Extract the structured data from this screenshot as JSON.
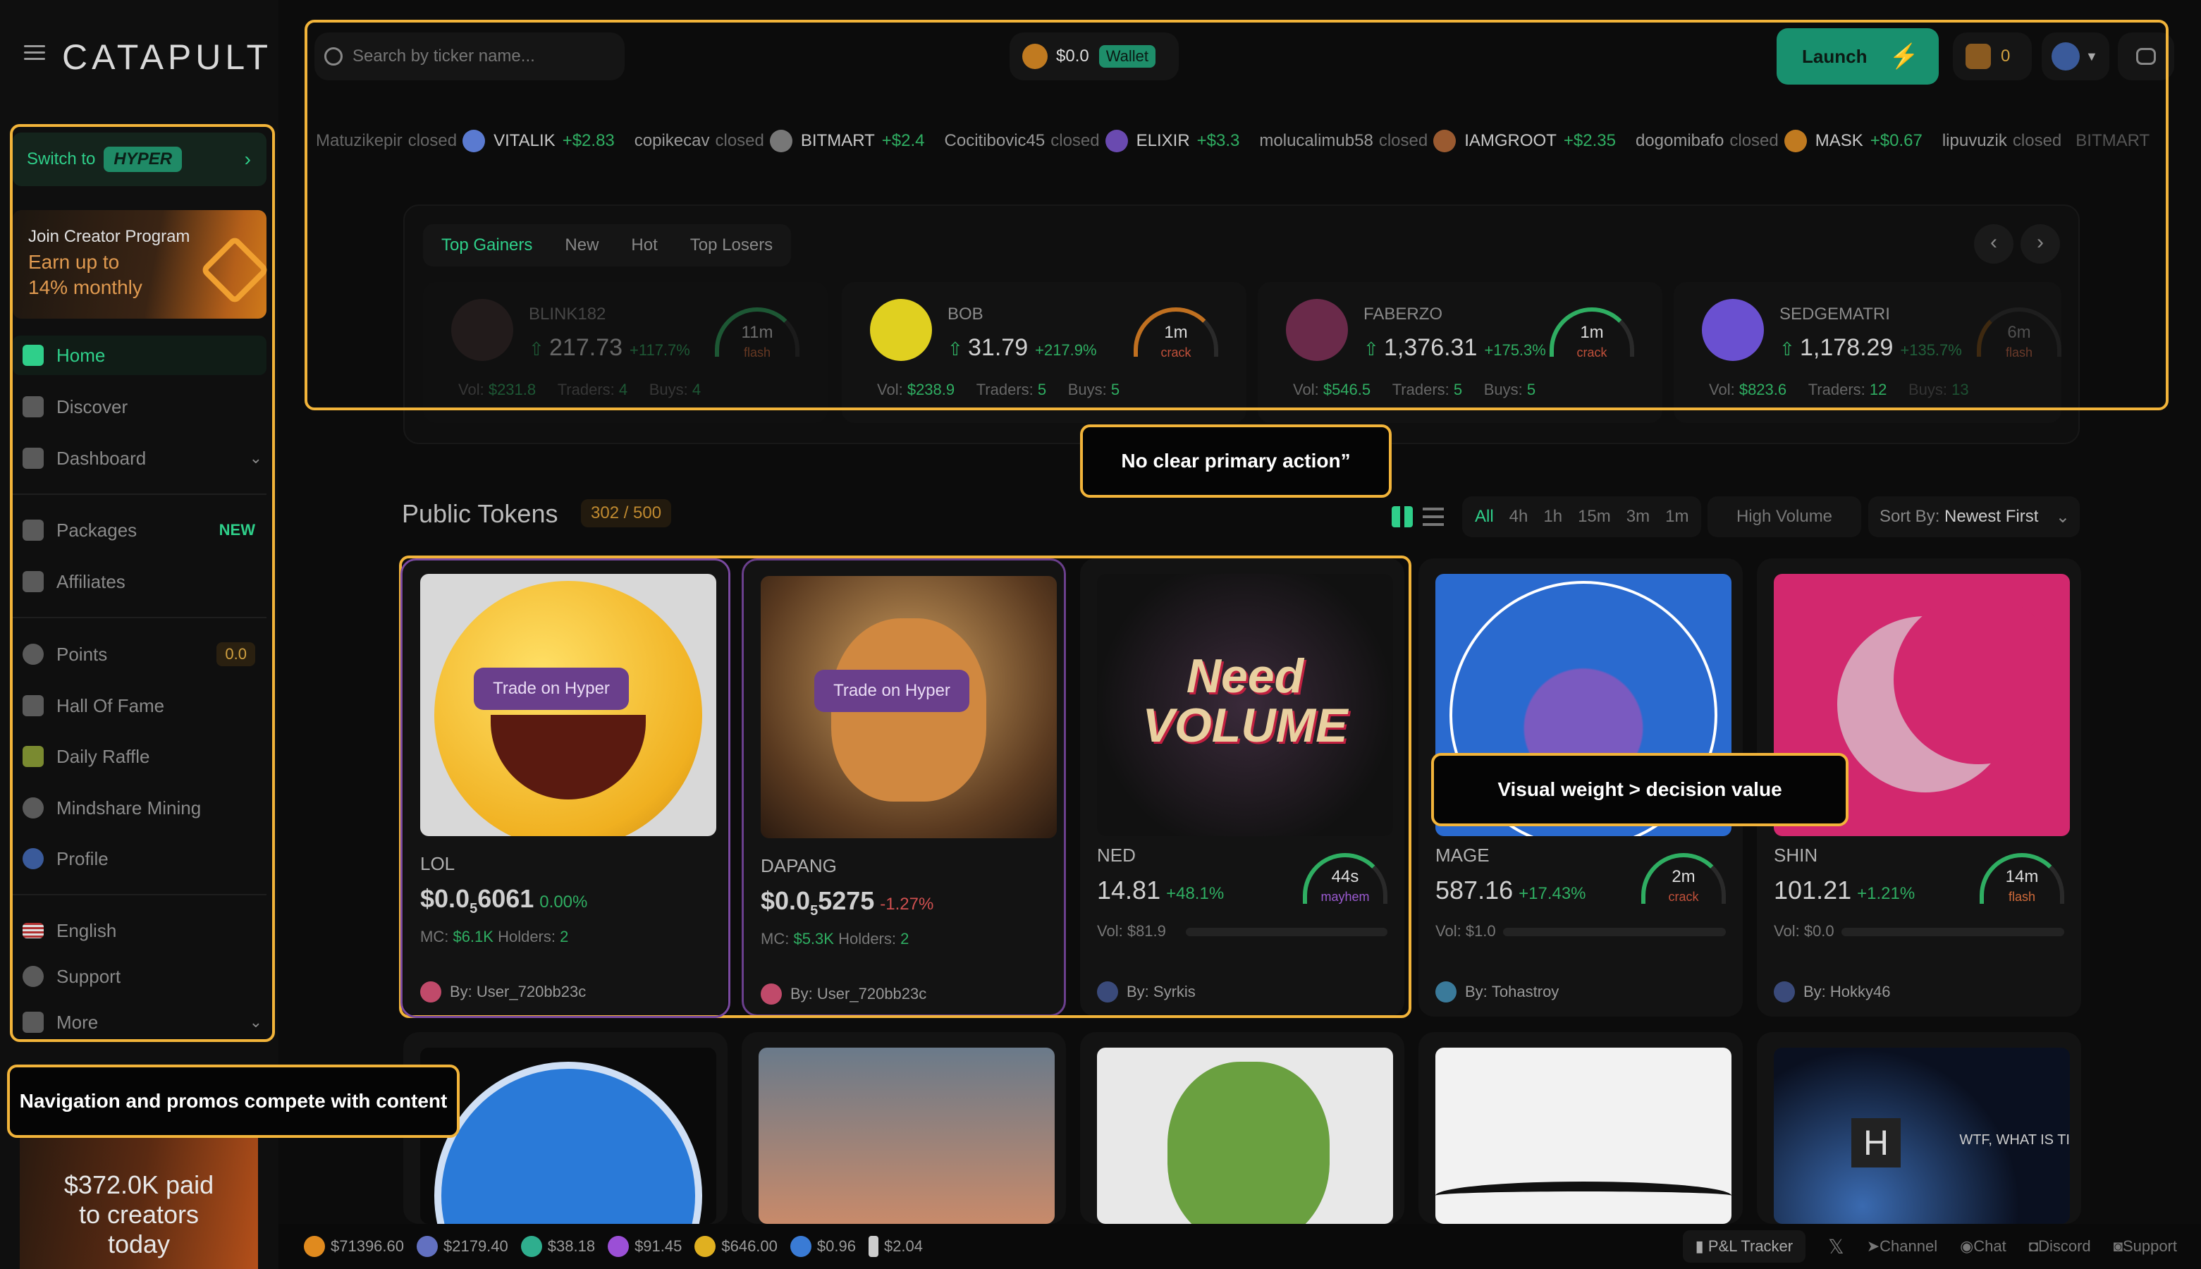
{
  "app": {
    "logo": "CATAPULT"
  },
  "search": {
    "placeholder": "Search by ticker name..."
  },
  "wallet": {
    "balance": "$0.0",
    "badge": "Wallet"
  },
  "header": {
    "launch_label": "Launch",
    "points": "0"
  },
  "sidebar": {
    "switch_label": "Switch to",
    "switch_badge": "HYPER",
    "promo": {
      "line1": "Join Creator Program",
      "line2": "Earn up to",
      "line3": "14% monthly"
    },
    "items": [
      {
        "label": "Home",
        "icon": "home-icon"
      },
      {
        "label": "Discover",
        "icon": "chart-icon"
      },
      {
        "label": "Dashboard",
        "icon": "grid-icon"
      },
      {
        "label": "Packages",
        "icon": "coins-icon",
        "badge": "NEW"
      },
      {
        "label": "Affiliates",
        "icon": "users-icon"
      },
      {
        "label": "Points",
        "icon": "plus-circle-icon",
        "value": "0.0"
      },
      {
        "label": "Hall Of Fame",
        "icon": "trophy-icon"
      },
      {
        "label": "Daily Raffle",
        "icon": "raffle-icon"
      },
      {
        "label": "Mindshare Mining",
        "icon": "dollar-icon"
      },
      {
        "label": "Profile",
        "icon": "avatar-icon"
      },
      {
        "label": "English",
        "icon": "flag-us-icon"
      },
      {
        "label": "Support",
        "icon": "help-icon"
      },
      {
        "label": "More",
        "icon": "more-icon"
      }
    ],
    "paid": {
      "line1": "$372.0K paid",
      "line2": "to creators",
      "line3": "today"
    }
  },
  "ticker": [
    {
      "user": "Matuzikepir",
      "status": "closed",
      "token": "VITALIK",
      "change": "+$2.83"
    },
    {
      "user": "copikecav",
      "status": "closed",
      "token": "BITMART",
      "change": "+$2.4"
    },
    {
      "user": "Cocitibovic45",
      "status": "closed",
      "token": "ELIXIR",
      "change": "+$3.3"
    },
    {
      "user": "molucalimub58",
      "status": "closed",
      "token": "IAMGROOT",
      "change": "+$2.35"
    },
    {
      "user": "dogomibafo",
      "status": "closed",
      "token": "MASK",
      "change": "+$0.67"
    },
    {
      "user": "lipuvuzik",
      "status": "closed",
      "token": "BITMART",
      "change": ""
    }
  ],
  "gainers": {
    "tabs": [
      "Top Gainers",
      "New",
      "Hot",
      "Top Losers"
    ],
    "cards": [
      {
        "name": "BLINK182",
        "price": "217.73",
        "pct": "+117.7%",
        "vol": "$231.8",
        "traders": "4",
        "buys": "4",
        "time": "11m",
        "stage": "flash",
        "stage_color": "#d06a3a"
      },
      {
        "name": "BOB",
        "price": "31.79",
        "pct": "+217.9%",
        "vol": "$238.9",
        "traders": "5",
        "buys": "5",
        "time": "1m",
        "stage": "crack",
        "stage_color": "#c0503a"
      },
      {
        "name": "FABERZO",
        "price": "1,376.31",
        "pct": "+175.3%",
        "vol": "$546.5",
        "traders": "5",
        "buys": "5",
        "time": "1m",
        "stage": "crack",
        "stage_color": "#c0503a"
      },
      {
        "name": "SEDGEMATRI",
        "price": "1,178.29",
        "pct": "+135.7%",
        "vol": "$823.6",
        "traders": "12",
        "buys": "13",
        "time": "6m",
        "stage": "flash",
        "stage_color": "#d06a3a"
      }
    ],
    "labels": {
      "vol": "Vol:",
      "traders": "Traders:",
      "buys": "Buys:"
    }
  },
  "callouts": {
    "primary": "No clear primary action”",
    "visual": "Visual weight > decision value",
    "nav": "Navigation and promos compete with content"
  },
  "public": {
    "title": "Public Tokens",
    "count": "302 / 500",
    "filters": [
      "All",
      "4h",
      "1h",
      "15m",
      "3m",
      "1m"
    ],
    "high_volume": "High Volume",
    "sort_label": "Sort By:",
    "sort_value": "Newest First",
    "trade_label": "Trade on Hyper",
    "by": "By:",
    "tokens": [
      {
        "name": "LOL",
        "price_a": "$0.0",
        "price_sub": "5",
        "price_b": "6061",
        "pct": "0.00%",
        "pct_color": "#2fae62",
        "mc": "$6.1K",
        "holders": "2",
        "by": "User_720bb23c"
      },
      {
        "name": "DAPANG",
        "price_a": "$0.0",
        "price_sub": "5",
        "price_b": "5275",
        "pct": "-1.27%",
        "pct_color": "#d05050",
        "mc": "$5.3K",
        "holders": "2",
        "by": "User_720bb23c"
      },
      {
        "name": "NED",
        "price": "14.81",
        "pct": "+48.1%",
        "vol": "$81.9",
        "time": "44s",
        "stage": "mayhem",
        "stage_color": "#9a5ad0",
        "by": "Syrkis",
        "img_text": "Need VOLUME"
      },
      {
        "name": "MAGE",
        "price": "587.16",
        "pct": "+17.43%",
        "vol": "$1.0",
        "time": "2m",
        "stage": "crack",
        "stage_color": "#c0503a",
        "by": "Tohastroy"
      },
      {
        "name": "SHIN",
        "price": "101.21",
        "pct": "+1.21%",
        "vol": "$0.0",
        "time": "14m",
        "stage": "flash",
        "stage_color": "#d06a3a",
        "by": "Hokky46"
      }
    ],
    "mc_label": "MC:",
    "holders_label": "Holders:",
    "vol_label": "Vol:",
    "row2_text": "WTF, WHAT IS TI",
    "row2_glyph": "H"
  },
  "bottom": {
    "coins": [
      {
        "value": "$71396.60",
        "color": "#e08a1e"
      },
      {
        "value": "$2179.40",
        "color": "#6270c0"
      },
      {
        "value": "$38.18",
        "color": "#2fae8e"
      },
      {
        "value": "$91.45",
        "color": "#9b4fd6"
      },
      {
        "value": "$646.00",
        "color": "#e0b020"
      },
      {
        "value": "$0.96",
        "color": "#3a7bd5"
      },
      {
        "value": "$2.04",
        "color": "#cccccc"
      }
    ],
    "links": [
      "P&L Tracker",
      "Channel",
      "Chat",
      "Discord",
      "Support"
    ]
  }
}
